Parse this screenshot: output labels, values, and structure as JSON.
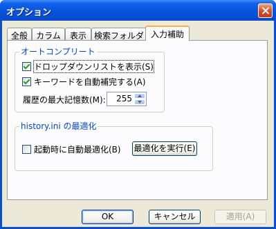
{
  "window": {
    "title": "オプション"
  },
  "tabs": [
    {
      "label": "全般"
    },
    {
      "label": "カラム"
    },
    {
      "label": "表示"
    },
    {
      "label": "検索フォルダ"
    },
    {
      "label": "入力補助"
    }
  ],
  "active_tab": "入力補助",
  "autocomplete": {
    "group_title": "オートコンプリート",
    "dropdown_checkbox": {
      "label": "ドロップダウンリストを表示(S)",
      "checked": true
    },
    "keyword_checkbox": {
      "label": "キーワードを自動補完する(A)",
      "checked": true
    },
    "history_label": "履歴の最大記憶数(M):",
    "history_value": "255"
  },
  "history_ini": {
    "group_title": "history.ini の最適化",
    "startup_checkbox": {
      "label": "起動時に自動最適化(B)",
      "checked": false
    },
    "optimize_button": "最適化を実行(E)"
  },
  "buttons": {
    "ok": "OK",
    "cancel": "キャンセル",
    "apply": "適用(A)"
  },
  "colors": {
    "titlebar": "#0553dc",
    "group_title": "#0046d5",
    "active_tab_highlight": "#f6b43a"
  }
}
